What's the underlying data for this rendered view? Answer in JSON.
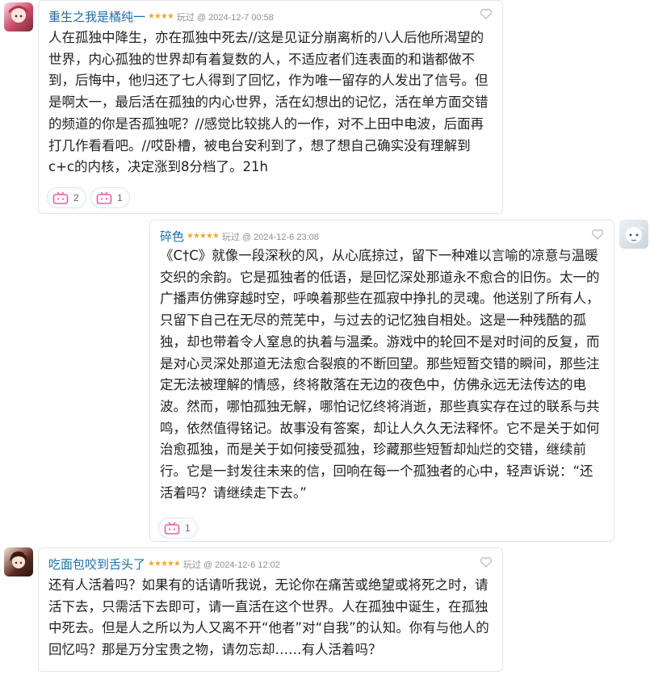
{
  "comments": [
    {
      "username": "重生之我是橘纯一",
      "stars": "★★★★",
      "meta": "玩过 @ 2024-12-7 00:58",
      "text": "人在孤独中降生，亦在孤独中死去//这是见证分崩离析的八人后他所渴望的\n世界，内心孤独的世界却有着复数的人，不适应者们连表面的和谐都做不\n到，后悔中，他归还了七人得到了回忆，作为唯一留存的人发出了信号。但\n是啊太一，最后活在孤独的内心世界，活在幻想出的记忆，活在单方面交错\n的频道的你是否孤独呢？//感觉比较挑人的一作，对不上田中电波，后面再\n打几作看看吧。//哎卧槽，被电台安利到了，想了想自己确实没有理解到\nc+c的内核，决定涨到8分档了。21h",
      "reactions": [
        {
          "icon": "tv-pink-icon",
          "count": "2"
        },
        {
          "icon": "tv-pink-icon",
          "count": "1"
        }
      ]
    },
    {
      "username": "碎色",
      "stars": "★★★★★",
      "meta": "玩过 @ 2024-12-6 23:08",
      "text": "《C†C》就像一段深秋的风，从心底掠过，留下一种难以言喻的凉意与温暖\n交织的余韵。它是孤独者的低语，是回忆深处那道永不愈合的旧伤。太一的\n广播声仿佛穿越时空，呼唤着那些在孤寂中挣扎的灵魂。他送别了所有人，\n只留下自己在无尽的荒芜中，与过去的记忆独自相处。这是一种残酷的孤\n独，却也带着令人窒息的执着与温柔。游戏中的轮回不是对时间的反复，而\n是对心灵深处那道无法愈合裂痕的不断回望。那些短暂交错的瞬间，那些注\n定无法被理解的情感，终将散落在无边的夜色中，仿佛永远无法传达的电\n波。然而，哪怕孤独无解，哪怕记忆终将消逝，那些真实存在过的联系与共\n鸣，依然值得铭记。故事没有答案，却让人久久无法释怀。它不是关于如何\n治愈孤独，而是关于如何接受孤独，珍藏那些短暂却灿烂的交错，继续前\n行。它是一封发往未来的信，回响在每一个孤独者的心中，轻声诉说：“还\n活着吗？请继续走下去。”",
      "reactions": [
        {
          "icon": "tv-pink-icon",
          "count": "1"
        }
      ]
    },
    {
      "username": "吃面包咬到舌头了",
      "stars": "★★★★★",
      "meta": "玩过 @ 2024-12-6 12:02",
      "text": "还有人活着吗？如果有的话请听我说，无论你在痛苦或绝望或将死之时，请\n活下去，只需活下去即可，请一直活在这个世界。人在孤独中诞生，在孤独\n中死去。但是人之所以为人又离不开“他者”对“自我”的认知。你有与他人的\n回忆吗？那是万分宝贵之物，请勿忘却……有人活着吗？",
      "reactions": []
    }
  ],
  "colors": {
    "username": "#1a6fa6",
    "stars": "#f0a830",
    "meta": "#8f8f8f",
    "tv": "#f25d9c"
  }
}
